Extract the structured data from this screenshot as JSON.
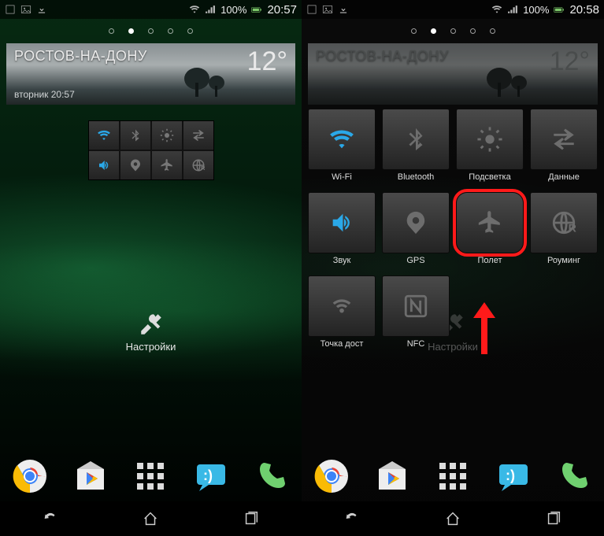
{
  "left": {
    "status": {
      "battery_pct": "100%",
      "clock": "20:57"
    },
    "page_dots": {
      "count": 5,
      "active_index": 1
    },
    "weather": {
      "city": "РОСТОВ-НА-ДОНУ",
      "day_time": "вторник 20:57",
      "temperature": "12°"
    },
    "mini_toggles": [
      {
        "name": "wifi-icon",
        "on": true
      },
      {
        "name": "bluetooth-icon",
        "on": false
      },
      {
        "name": "brightness-icon",
        "on": false
      },
      {
        "name": "data-arrows-icon",
        "on": false
      },
      {
        "name": "sound-icon",
        "on": true
      },
      {
        "name": "gps-icon",
        "on": false
      },
      {
        "name": "airplane-icon",
        "on": false
      },
      {
        "name": "roaming-icon",
        "on": false
      }
    ],
    "settings_label": "Настройки",
    "dock": [
      {
        "name": "chrome-app"
      },
      {
        "name": "play-store-app"
      },
      {
        "name": "app-drawer"
      },
      {
        "name": "messaging-app"
      },
      {
        "name": "phone-app"
      }
    ]
  },
  "right": {
    "status": {
      "battery_pct": "100%",
      "clock": "20:58"
    },
    "page_dots": {
      "count": 5,
      "active_index": 1
    },
    "weather": {
      "city": "РОСТОВ-НА-ДОНУ",
      "day_time": "",
      "temperature": "12°"
    },
    "qs_tiles": [
      {
        "name": "wifi",
        "label": "Wi-Fi",
        "on": true
      },
      {
        "name": "bluetooth",
        "label": "Bluetooth",
        "on": false
      },
      {
        "name": "brightness",
        "label": "Подсветка",
        "on": false
      },
      {
        "name": "data",
        "label": "Данные",
        "on": false
      },
      {
        "name": "sound",
        "label": "Звук",
        "on": true
      },
      {
        "name": "gps",
        "label": "GPS",
        "on": false
      },
      {
        "name": "airplane",
        "label": "Полет",
        "on": false,
        "highlight": true
      },
      {
        "name": "roaming",
        "label": "Роуминг",
        "on": false
      },
      {
        "name": "hotspot",
        "label": "Точка дост",
        "on": false
      },
      {
        "name": "nfc",
        "label": "NFC",
        "on": false
      }
    ],
    "settings_label": "Настройки",
    "annotation": {
      "arrow_points_to": "airplane"
    }
  },
  "icons": {
    "wifi": "wifi-icon",
    "bluetooth": "bluetooth-icon",
    "brightness": "brightness-icon",
    "data": "data-arrows-icon",
    "sound": "sound-icon",
    "gps": "gps-icon",
    "airplane": "airplane-icon",
    "roaming": "roaming-icon",
    "hotspot": "hotspot-icon",
    "nfc": "nfc-icon"
  }
}
